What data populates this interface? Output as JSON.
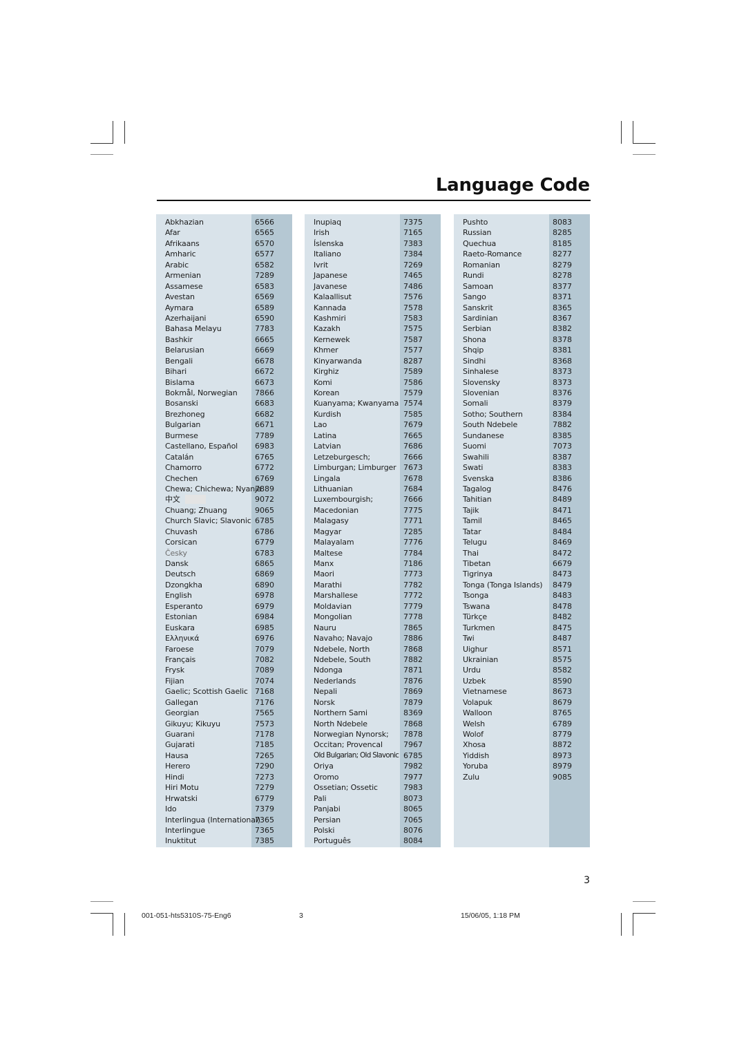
{
  "page": {
    "title": "Language Code",
    "page_number": "3"
  },
  "footer": {
    "file_name": "001-051-hts5310S-75-Eng6",
    "page": "3",
    "timestamp": "15/06/05, 1:18 PM"
  },
  "columns": [
    {
      "entries": [
        {
          "name": "Abkhazian",
          "code": "6566"
        },
        {
          "name": "Afar",
          "code": "6565"
        },
        {
          "name": "Afrikaans",
          "code": "6570"
        },
        {
          "name": "Amharic",
          "code": "6577"
        },
        {
          "name": "Arabic",
          "code": "6582"
        },
        {
          "name": "Armenian",
          "code": "7289"
        },
        {
          "name": "Assamese",
          "code": "6583"
        },
        {
          "name": "Avestan",
          "code": "6569"
        },
        {
          "name": "Aymara",
          "code": "6589"
        },
        {
          "name": "Azerhaijani",
          "code": "6590"
        },
        {
          "name": "Bahasa Melayu",
          "code": "7783"
        },
        {
          "name": "Bashkir",
          "code": "6665"
        },
        {
          "name": "Belarusian",
          "code": "6669"
        },
        {
          "name": "Bengali",
          "code": "6678"
        },
        {
          "name": "Bihari",
          "code": "6672"
        },
        {
          "name": "Bislama",
          "code": "6673"
        },
        {
          "name": "Bokmål, Norwegian",
          "code": "7866"
        },
        {
          "name": "Bosanski",
          "code": "6683"
        },
        {
          "name": "Brezhoneg",
          "code": "6682"
        },
        {
          "name": "Bulgarian",
          "code": "6671"
        },
        {
          "name": "Burmese",
          "code": "7789"
        },
        {
          "name": "Castellano, Español",
          "code": "6983"
        },
        {
          "name": "Catalán",
          "code": "6765"
        },
        {
          "name": "Chamorro",
          "code": "6772"
        },
        {
          "name": "Chechen",
          "code": "6769"
        },
        {
          "name": "Chewa; Chichewa; Nyanja",
          "code": "7889"
        },
        {
          "name": "中文",
          "code": "9072"
        },
        {
          "name": "Chuang; Zhuang",
          "code": "9065"
        },
        {
          "name": "Church Slavic; Slavonic",
          "code": "6785"
        },
        {
          "name": "Chuvash",
          "code": "6786"
        },
        {
          "name": "Corsican",
          "code": "6779"
        },
        {
          "name": "Česky",
          "code": "6783"
        },
        {
          "name": "Dansk",
          "code": "6865"
        },
        {
          "name": "Deutsch",
          "code": "6869"
        },
        {
          "name": "Dzongkha",
          "code": "6890"
        },
        {
          "name": "English",
          "code": "6978"
        },
        {
          "name": "Esperanto",
          "code": "6979"
        },
        {
          "name": "Estonian",
          "code": "6984"
        },
        {
          "name": "Euskara",
          "code": "6985"
        },
        {
          "name": "Ελληνικά",
          "code": "6976"
        },
        {
          "name": "Faroese",
          "code": "7079"
        },
        {
          "name": "Français",
          "code": "7082"
        },
        {
          "name": "Frysk",
          "code": "7089"
        },
        {
          "name": "Fijian",
          "code": "7074"
        },
        {
          "name": "Gaelic; Scottish Gaelic",
          "code": "7168"
        },
        {
          "name": "Gallegan",
          "code": "7176"
        },
        {
          "name": "Georgian",
          "code": "7565"
        },
        {
          "name": "Gikuyu; Kikuyu",
          "code": "7573"
        },
        {
          "name": "Guarani",
          "code": "7178"
        },
        {
          "name": "Gujarati",
          "code": "7185"
        },
        {
          "name": "Hausa",
          "code": "7265"
        },
        {
          "name": "Herero",
          "code": "7290"
        },
        {
          "name": "Hindi",
          "code": "7273"
        },
        {
          "name": "Hiri Motu",
          "code": "7279"
        },
        {
          "name": "Hrwatski",
          "code": "6779"
        },
        {
          "name": "Ido",
          "code": "7379"
        },
        {
          "name": "Interlingua (International)",
          "code": "7365"
        },
        {
          "name": "Interlingue",
          "code": "7365"
        },
        {
          "name": "Inuktitut",
          "code": "7385"
        }
      ]
    },
    {
      "entries": [
        {
          "name": "Inupiaq",
          "code": "7375"
        },
        {
          "name": "Irish",
          "code": "7165"
        },
        {
          "name": "Íslenska",
          "code": "7383"
        },
        {
          "name": "Italiano",
          "code": "7384"
        },
        {
          "name": "Ivrit",
          "code": "7269"
        },
        {
          "name": "Japanese",
          "code": "7465"
        },
        {
          "name": "Javanese",
          "code": "7486"
        },
        {
          "name": "Kalaallisut",
          "code": "7576"
        },
        {
          "name": "Kannada",
          "code": "7578"
        },
        {
          "name": "Kashmiri",
          "code": "7583"
        },
        {
          "name": "Kazakh",
          "code": "7575"
        },
        {
          "name": "Kernewek",
          "code": "7587"
        },
        {
          "name": "Khmer",
          "code": "7577"
        },
        {
          "name": "Kinyarwanda",
          "code": "8287"
        },
        {
          "name": "Kirghiz",
          "code": "7589"
        },
        {
          "name": "Komi",
          "code": "7586"
        },
        {
          "name": "Korean",
          "code": "7579"
        },
        {
          "name": "Kuanyama; Kwanyama",
          "code": "7574"
        },
        {
          "name": "Kurdish",
          "code": "7585"
        },
        {
          "name": "Lao",
          "code": "7679"
        },
        {
          "name": "Latina",
          "code": "7665"
        },
        {
          "name": "Latvian",
          "code": "7686"
        },
        {
          "name": "Letzeburgesch;",
          "code": "7666"
        },
        {
          "name": "Limburgan; Limburger",
          "code": "7673"
        },
        {
          "name": "Lingala",
          "code": "7678"
        },
        {
          "name": "Lithuanian",
          "code": "7684"
        },
        {
          "name": "Luxembourgish;",
          "code": "7666"
        },
        {
          "name": "Macedonian",
          "code": "7775"
        },
        {
          "name": "Malagasy",
          "code": "7771"
        },
        {
          "name": "Magyar",
          "code": "7285"
        },
        {
          "name": "Malayalam",
          "code": "7776"
        },
        {
          "name": "Maltese",
          "code": "7784"
        },
        {
          "name": "Manx",
          "code": "7186"
        },
        {
          "name": "Maori",
          "code": "7773"
        },
        {
          "name": "Marathi",
          "code": "7782"
        },
        {
          "name": "Marshallese",
          "code": "7772"
        },
        {
          "name": "Moldavian",
          "code": "7779"
        },
        {
          "name": "Mongolian",
          "code": "7778"
        },
        {
          "name": "Nauru",
          "code": "7865"
        },
        {
          "name": "Navaho; Navajo",
          "code": "7886"
        },
        {
          "name": "Ndebele, North",
          "code": "7868"
        },
        {
          "name": "Ndebele, South",
          "code": "7882"
        },
        {
          "name": "Ndonga",
          "code": "7871"
        },
        {
          "name": "Nederlands",
          "code": "7876"
        },
        {
          "name": "Nepali",
          "code": "7869"
        },
        {
          "name": "Norsk",
          "code": "7879"
        },
        {
          "name": "Northern Sami",
          "code": "8369"
        },
        {
          "name": "North Ndebele",
          "code": "7868"
        },
        {
          "name": "Norwegian Nynorsk;",
          "code": "7878"
        },
        {
          "name": "Occitan; Provencal",
          "code": "7967"
        },
        {
          "name": "Old Bulgarian; Old Slavonic",
          "code": "6785"
        },
        {
          "name": "Oriya",
          "code": "7982"
        },
        {
          "name": "Oromo",
          "code": "7977"
        },
        {
          "name": "Ossetian; Ossetic",
          "code": "7983"
        },
        {
          "name": "Pali",
          "code": "8073"
        },
        {
          "name": "Panjabi",
          "code": "8065"
        },
        {
          "name": "Persian",
          "code": "7065"
        },
        {
          "name": "Polski",
          "code": "8076"
        },
        {
          "name": "Português",
          "code": "8084"
        }
      ]
    },
    {
      "entries": [
        {
          "name": "Pushto",
          "code": "8083"
        },
        {
          "name": "Russian",
          "code": "8285"
        },
        {
          "name": "Quechua",
          "code": "8185"
        },
        {
          "name": "Raeto-Romance",
          "code": "8277"
        },
        {
          "name": "Romanian",
          "code": "8279"
        },
        {
          "name": "Rundi",
          "code": "8278"
        },
        {
          "name": "Samoan",
          "code": "8377"
        },
        {
          "name": "Sango",
          "code": "8371"
        },
        {
          "name": "Sanskrit",
          "code": "8365"
        },
        {
          "name": "Sardinian",
          "code": "8367"
        },
        {
          "name": "Serbian",
          "code": "8382"
        },
        {
          "name": "Shona",
          "code": "8378"
        },
        {
          "name": "Shqip",
          "code": "8381"
        },
        {
          "name": "Sindhi",
          "code": "8368"
        },
        {
          "name": "Sinhalese",
          "code": "8373"
        },
        {
          "name": "Slovensky",
          "code": "8373"
        },
        {
          "name": "Slovenian",
          "code": "8376"
        },
        {
          "name": "Somali",
          "code": "8379"
        },
        {
          "name": "Sotho; Southern",
          "code": "8384"
        },
        {
          "name": "South Ndebele",
          "code": "7882"
        },
        {
          "name": "Sundanese",
          "code": "8385"
        },
        {
          "name": "Suomi",
          "code": "7073"
        },
        {
          "name": "Swahili",
          "code": "8387"
        },
        {
          "name": "Swati",
          "code": "8383"
        },
        {
          "name": "Svenska",
          "code": "8386"
        },
        {
          "name": "Tagalog",
          "code": "8476"
        },
        {
          "name": "Tahitian",
          "code": "8489"
        },
        {
          "name": "Tajik",
          "code": "8471"
        },
        {
          "name": "Tamil",
          "code": "8465"
        },
        {
          "name": "Tatar",
          "code": "8484"
        },
        {
          "name": "Telugu",
          "code": "8469"
        },
        {
          "name": "Thai",
          "code": "8472"
        },
        {
          "name": "Tibetan",
          "code": "6679"
        },
        {
          "name": "Tigrinya",
          "code": "8473"
        },
        {
          "name": "Tonga (Tonga Islands)",
          "code": "8479"
        },
        {
          "name": "Tsonga",
          "code": "8483"
        },
        {
          "name": "Tswana",
          "code": "8478"
        },
        {
          "name": "Türkçe",
          "code": "8482"
        },
        {
          "name": "Turkmen",
          "code": "8475"
        },
        {
          "name": "Twi",
          "code": "8487"
        },
        {
          "name": "Uighur",
          "code": "8571"
        },
        {
          "name": "Ukrainian",
          "code": "8575"
        },
        {
          "name": "Urdu",
          "code": "8582"
        },
        {
          "name": "Uzbek",
          "code": "8590"
        },
        {
          "name": "Vietnamese",
          "code": "8673"
        },
        {
          "name": "Volapuk",
          "code": "8679"
        },
        {
          "name": "Walloon",
          "code": "8765"
        },
        {
          "name": "Welsh",
          "code": "6789"
        },
        {
          "name": "Wolof",
          "code": "8779"
        },
        {
          "name": "Xhosa",
          "code": "8872"
        },
        {
          "name": "Yiddish",
          "code": "8973"
        },
        {
          "name": "Yoruba",
          "code": "8979"
        },
        {
          "name": "Zulu",
          "code": "9085"
        }
      ]
    }
  ]
}
